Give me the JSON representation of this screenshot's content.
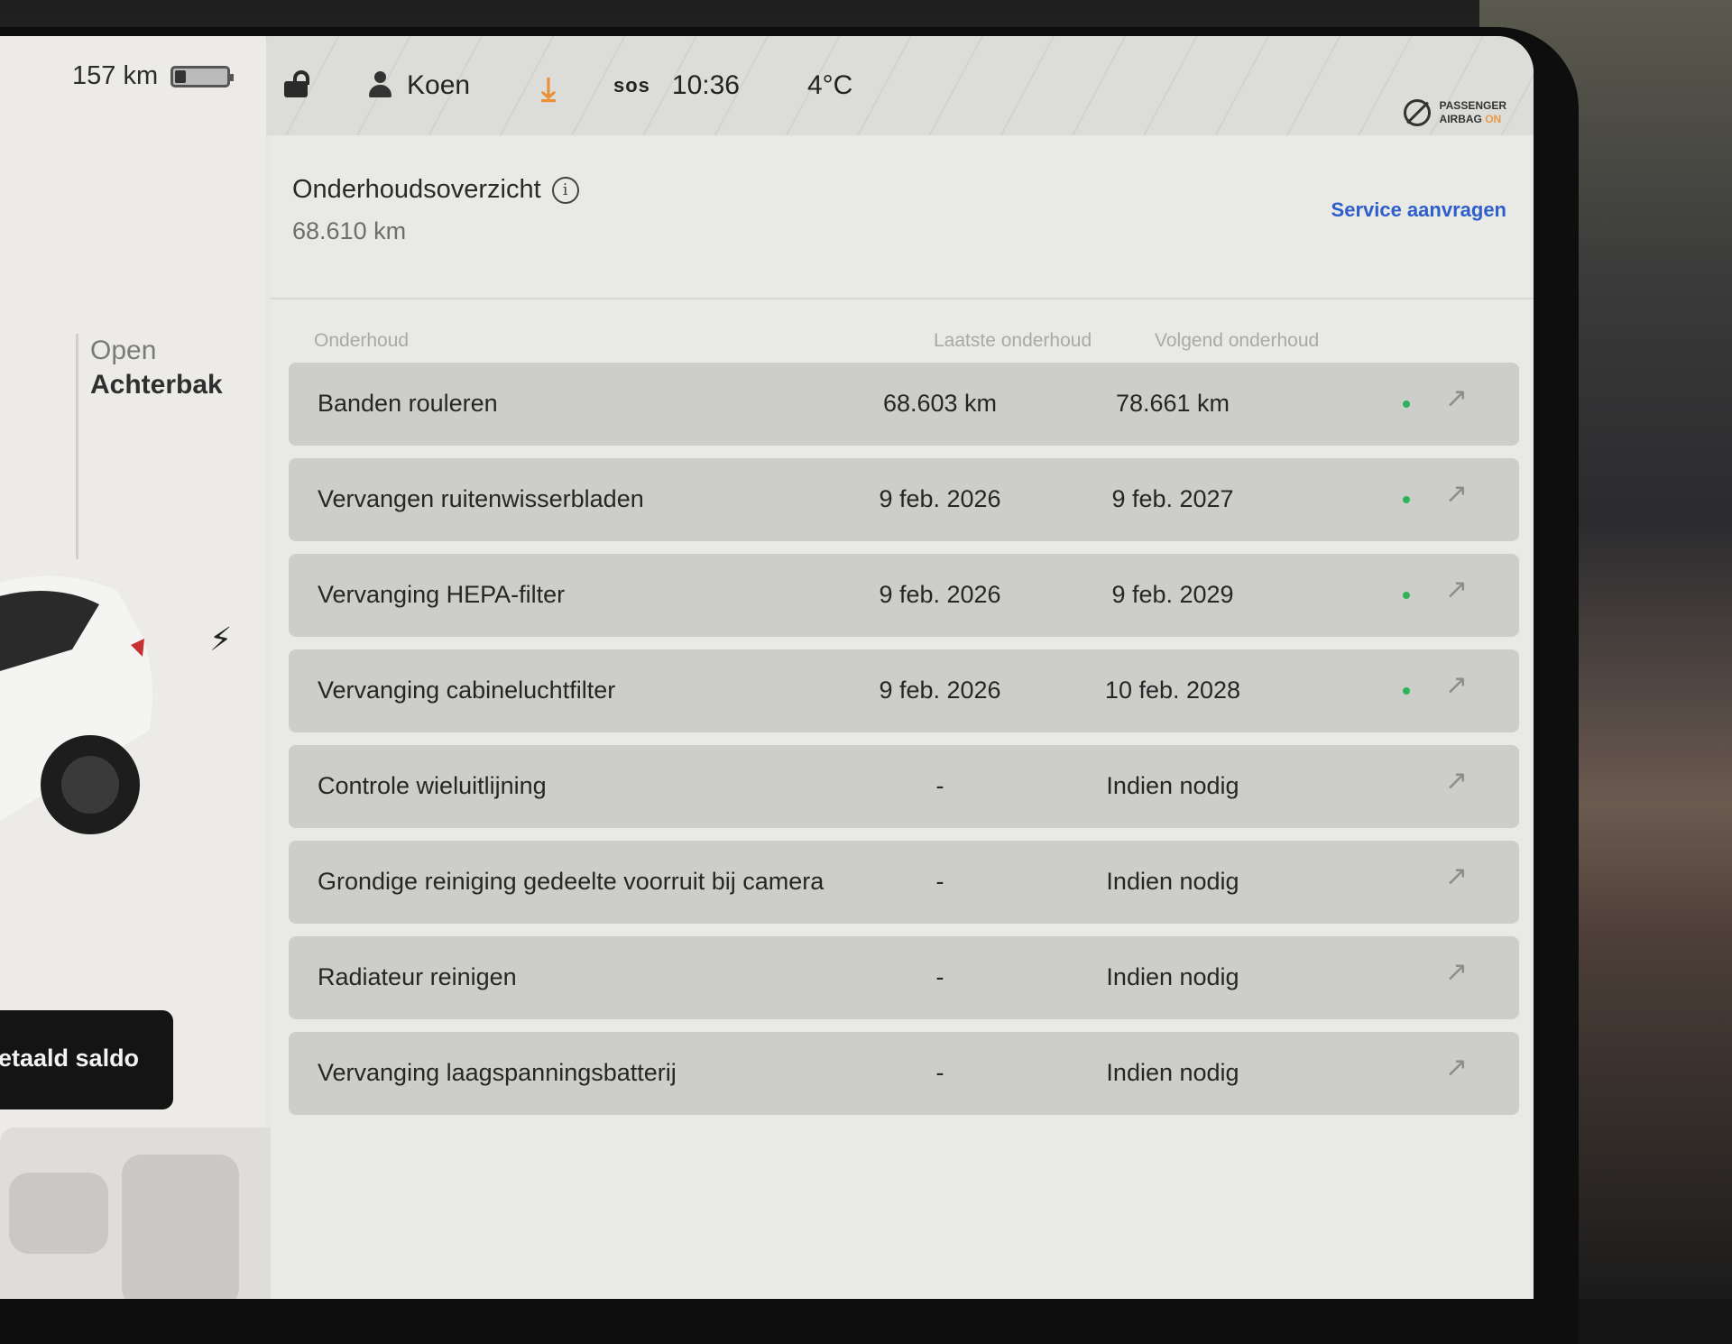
{
  "status_bar": {
    "range": "157 km",
    "battery_level": 0.2,
    "profile_name": "Koen",
    "sos_label": "sos",
    "time": "10:36",
    "temperature": "4°C",
    "airbag_line1": "PASSENGER",
    "airbag_line2": "AIRBAG",
    "airbag_state": "ON"
  },
  "left_panel": {
    "trunk_action": "Open",
    "trunk_label": "Achterbak",
    "balance_button": "etaald saldo"
  },
  "maintenance": {
    "title": "Onderhoudsoverzicht",
    "odometer": "68.610  km",
    "service_link": "Service aanvragen",
    "columns": {
      "item": "Onderhoud",
      "last": "Laatste onderhoud",
      "next": "Volgend onderhoud"
    },
    "rows": [
      {
        "name": "Banden rouleren",
        "last": "68.603 km",
        "next": "78.661 km",
        "status": "ok"
      },
      {
        "name": "Vervangen ruitenwisserbladen",
        "last": "9 feb. 2026",
        "next": "9 feb. 2027",
        "status": "ok"
      },
      {
        "name": "Vervanging HEPA-filter",
        "last": "9 feb. 2026",
        "next": "9 feb. 2029",
        "status": "ok"
      },
      {
        "name": "Vervanging cabineluchtfilter",
        "last": "9 feb. 2026",
        "next": "10 feb. 2028",
        "status": "ok"
      },
      {
        "name": "Controle wieluitlijning",
        "last": "-",
        "next": "Indien nodig",
        "status": "none"
      },
      {
        "name": "Grondige reiniging gedeelte voorruit bij camera",
        "last": "-",
        "next": "Indien nodig",
        "status": "none"
      },
      {
        "name": "Radiateur reinigen",
        "last": "-",
        "next": "Indien nodig",
        "status": "none"
      },
      {
        "name": "Vervanging laagspanningsbatterij",
        "last": "-",
        "next": "Indien nodig",
        "status": "none"
      }
    ]
  },
  "colors": {
    "accent_link": "#2d5ecb",
    "status_ok": "#2eb35a",
    "download_icon": "#e8903a"
  }
}
